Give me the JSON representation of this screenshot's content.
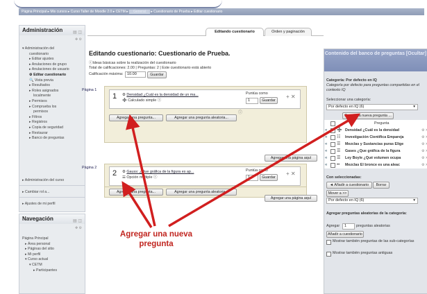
{
  "breadcrumb": {
    "parts": [
      "Página Principal",
      "Mis cursos",
      "Curso Taller de Moodle 2.0",
      "CETM",
      "Cuestionario de Prueba",
      "Editar cuestionario"
    ],
    "highlight": "General"
  },
  "admin": {
    "title": "Administración",
    "items": [
      "Administración del",
      "cuestionario",
      "Editar ajustes",
      "Anulaciones de grupo",
      "Anulaciones de usuario",
      "Editar cuestionario",
      "Vista previa",
      "Resultados",
      "Roles asignados",
      "localmente",
      "Permisos",
      "Comprueba los",
      "permisos",
      "Filtros",
      "Registros",
      "Copia de seguridad",
      "Restaurar",
      "Banco de preguntas"
    ],
    "course_admin": "Administración del curso",
    "switch_role": "Cambiar rol a...",
    "profile": "Ajustes de mi perfil"
  },
  "nav": {
    "title": "Navegación",
    "items": [
      "Página Principal",
      "Área personal",
      "Páginas del sitio",
      "Mi perfil",
      "Curso actual",
      "CETM",
      "Participantes"
    ]
  },
  "tabs": {
    "edit": "Editando cuestionario",
    "order": "Orden y paginación"
  },
  "main": {
    "heading": "Editando cuestionario: Cuestionario de Prueba.",
    "help": "Ideas básicas sobre la realización del cuestionario",
    "total": "Total de calificaciones: 2.00 | Preguntas: 2 | Este cuestionario está abierto",
    "max_label": "Calificación máxima:",
    "max_value": "10.00",
    "save": "Guardar",
    "page1": "Página 1",
    "page2": "Página 2",
    "q1": {
      "num": "1",
      "title": "Densidad ¿Cuál es la densidad de un ma...",
      "type": "Calculado simple",
      "points_label": "Puntúa como",
      "points": "1",
      "save": "Guardar"
    },
    "q2": {
      "num": "2",
      "title": "Gauss: ¿Que gráfica de la figura es ap...",
      "type": "Opción múltiple",
      "points_label": "Puntúa como",
      "points": "1",
      "save": "Guardar"
    },
    "add_question": "Agregar una pregunta...",
    "add_random": "Agregar una pregunta aleatoria...",
    "add_page": "Agregar una página aquí"
  },
  "bank": {
    "title": "Contenido del banco de preguntas [Ocultar]",
    "category_label": "Categoría:",
    "category_value": "Por defecto en IQ",
    "category_desc": "Categoría por defecto para preguntas compartidas en el contexto IQ",
    "select_label": "Seleccionar una categoría:",
    "select_value": "Por defecto en IQ (6)",
    "create_new": "Crear una nueva pregunta ...",
    "col_question": "Pregunta",
    "questions": [
      "Densidad ¿Cuál es la densidad",
      "Investigación Científica Empareja",
      "Mezclas y Sustancias puras Elige",
      "Gases ¿Que gráfica de la figura",
      "Ley Boyle ¿Qué volumen ocupa",
      "Mezclas El bronce es una aleac"
    ],
    "with_selected": "Con seleccionadas:",
    "add_to_quiz": "◄ Añadir a cuestionario",
    "delete": "Borrar",
    "move": "Mover a >>",
    "move_target": "Por defecto en IQ (6)",
    "random_title": "Agregar preguntas aleatorias de la categoría:",
    "random_add": "Agregar",
    "random_count": "1",
    "random_suffix": "preguntas aleatorias",
    "random_btn": "Añadir a cuestionario",
    "show_sub": "Mostrar también preguntas de las sub-categorías",
    "show_old": "Mostrar también preguntas antiguas"
  },
  "annotation": "Agregar una nueva pregunta",
  "colors": {
    "arrow": "#d11f1f",
    "bank_header": "#8a98c0",
    "page_box": "#f2eeda"
  }
}
